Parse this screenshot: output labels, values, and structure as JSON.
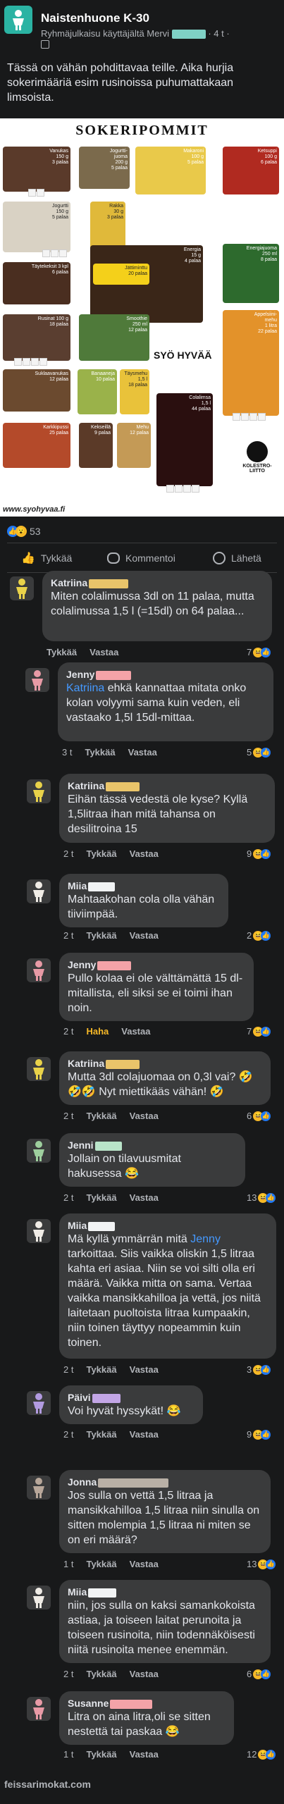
{
  "post": {
    "group_name": "Naistenhuone K-30",
    "posted_in": "Ryhmäjulkaisu käyttäjältä Mervi",
    "time": "· 4 t ·",
    "text": "Tässä on vähän pohdittavaa teille. Aika hurjia sokerimääriä esim rusinoissa puhumattakaan limsoista."
  },
  "poster": {
    "title": "SOKERIPOMMIT",
    "logo_text": "SYÖ HYVÄÄ",
    "url": "www.syohyvaa.fi",
    "badge": "KOLESTRO-LIITTO",
    "tiles": [
      {
        "caption": "Vanukas\n150 g\n3 palaa"
      },
      {
        "caption": "Jogurtti-\njuoma\n200 g\n5 palaa"
      },
      {
        "caption": "Makaroni\n100 g\n5 palaa"
      },
      {
        "caption": "Ketsuppi\n100 g\n6 palaa"
      },
      {
        "caption": "Jogurtti\n150 g\n5 palaa"
      },
      {
        "caption": "Rakka\n30 g\n3 palaa"
      },
      {
        "caption": "Täytekeksit 3 kpl\n6 palaa"
      },
      {
        "caption": "Energia\n15 g\n4 palaa"
      },
      {
        "caption": "Jättiminttu\n20 palaa"
      },
      {
        "caption": "Energiajuoma\n250 ml\n8 palaa"
      },
      {
        "caption": "Rusinat 100 g\n18 palaa"
      },
      {
        "caption": "Smoothie\n250 ml\n12 palaa"
      },
      {
        "caption": "Appelsiini-\nmehu\n1 litra\n22 palaa"
      },
      {
        "caption": "Suklaavanukas\n12 palaa"
      },
      {
        "caption": "Täysmehu\n1,5 l\n18 palaa"
      },
      {
        "caption": "Banaaneja\n10 palaa"
      },
      {
        "caption": "Colalimsa\n1,5 l\n44 palaa"
      },
      {
        "caption": "Karkkipussi\n25 palaa"
      },
      {
        "caption": "Kekseillä\n9 palaa"
      },
      {
        "caption": "Mehu\n12 palaa"
      }
    ]
  },
  "reactions": {
    "count": "53"
  },
  "actions": {
    "like": "Tykkää",
    "comment": "Kommentoi",
    "share": "Lähetä"
  },
  "comments": [
    {
      "author": "Katriina",
      "text": "Miten colalimussa 3dl on 11 palaa, mutta colalimussa 1,5 l (=15dl) on 64 palaa...",
      "time": "",
      "like": "Tykkää",
      "reply": "Vastaa",
      "count": "7",
      "color": "#e9c46a"
    },
    {
      "author": "Jenny",
      "mention": "Katriina",
      "text": " ehkä kannattaa mitata onko kolan volyymi sama kuin veden, eli vastaako 1,5l 15dl-mittaa.",
      "time": "3 t",
      "like": "Tykkää",
      "reply": "Vastaa",
      "count": "5",
      "color": "#f4a3a8"
    },
    {
      "author": "Katriina",
      "text": "Eihän tässä vedestä ole kyse? Kyllä 1,5litraa ihan mitä tahansa on desilitroina 15",
      "time": "2 t",
      "like": "Tykkää",
      "reply": "Vastaa",
      "count": "9",
      "color": "#e9c46a"
    },
    {
      "author": "Miia",
      "text": "Mahtaakohan cola olla vähän tiiviimpää.",
      "time": "2 t",
      "like": "Tykkää",
      "reply": "Vastaa",
      "count": "2",
      "color": "#f1f3f4"
    },
    {
      "author": "Jenny",
      "text": "Pullo kolaa ei ole välttämättä 15 dl-mitallista, eli siksi se ei toimi ihan noin.",
      "time": "2 t",
      "like": "Haha",
      "reply": "Vastaa",
      "count": "7",
      "color": "#f4a3a8"
    },
    {
      "author": "Katriina",
      "text": "Mutta 3dl colajuomaa on 0,3l vai? 🤣🤣🤣 Nyt miettikääs vähän! 🤣",
      "time": "2 t",
      "like": "Tykkää",
      "reply": "Vastaa",
      "count": "6",
      "color": "#e9c46a"
    },
    {
      "author": "Jenni",
      "text": "Jollain on tilavuusmitat hakusessa 😂",
      "time": "2 t",
      "like": "Tykkää",
      "reply": "Vastaa",
      "count": "13",
      "color": "#b9e4c9"
    },
    {
      "author": "Miia",
      "text_parts": [
        "Mä kyllä ymmärrän mitä ",
        "Jenny",
        " tarkoittaa. Siis vaikka oliskin 1,5 litraa kahta eri asiaa. Niin se voi silti olla eri määrä. Vaikka mitta on sama. Vertaa vaikka mansikkahilloa ja vettä, jos niitä laitetaan puoltoista litraa kumpaakin, niin toinen täyttyy nopeammin kuin toinen."
      ],
      "time": "2 t",
      "like": "Tykkää",
      "reply": "Vastaa",
      "count": "3",
      "color": "#f1f3f4"
    },
    {
      "author": "Päivi",
      "text": "Voi hyvät hyssykät! 😂",
      "time": "2 t",
      "like": "Tykkää",
      "reply": "Vastaa",
      "count": "9",
      "color": "#c3a6e6"
    },
    {
      "author": "Jonna",
      "text": "Jos sulla on vettä 1,5 litraa ja mansikkahilloa 1,5 litraa niin sinulla on sitten molempia 1,5 litraa ni miten se on eri määrä?",
      "time": "1 t",
      "like": "Tykkää",
      "reply": "Vastaa",
      "count": "13",
      "color": "#b9b0a6"
    },
    {
      "author": "Miia",
      "text": "niin, jos sulla on kaksi samankokoista astiaa, ja toiseen laitat perunoita ja toiseen rusinoita, niin todennäköisesti niitä rusinoita menee enemmän.",
      "time": "2 t",
      "like": "Tykkää",
      "reply": "Vastaa",
      "count": "6",
      "color": "#f1f3f4"
    },
    {
      "author": "Susanne",
      "text": "Litra on aina litra,oli se sitten nestettä tai paskaa 😂",
      "time": "1 t",
      "like": "Tykkää",
      "reply": "Vastaa",
      "count": "12",
      "color": "#f4a3a8"
    }
  ],
  "watermark": "feissarimokat.com"
}
